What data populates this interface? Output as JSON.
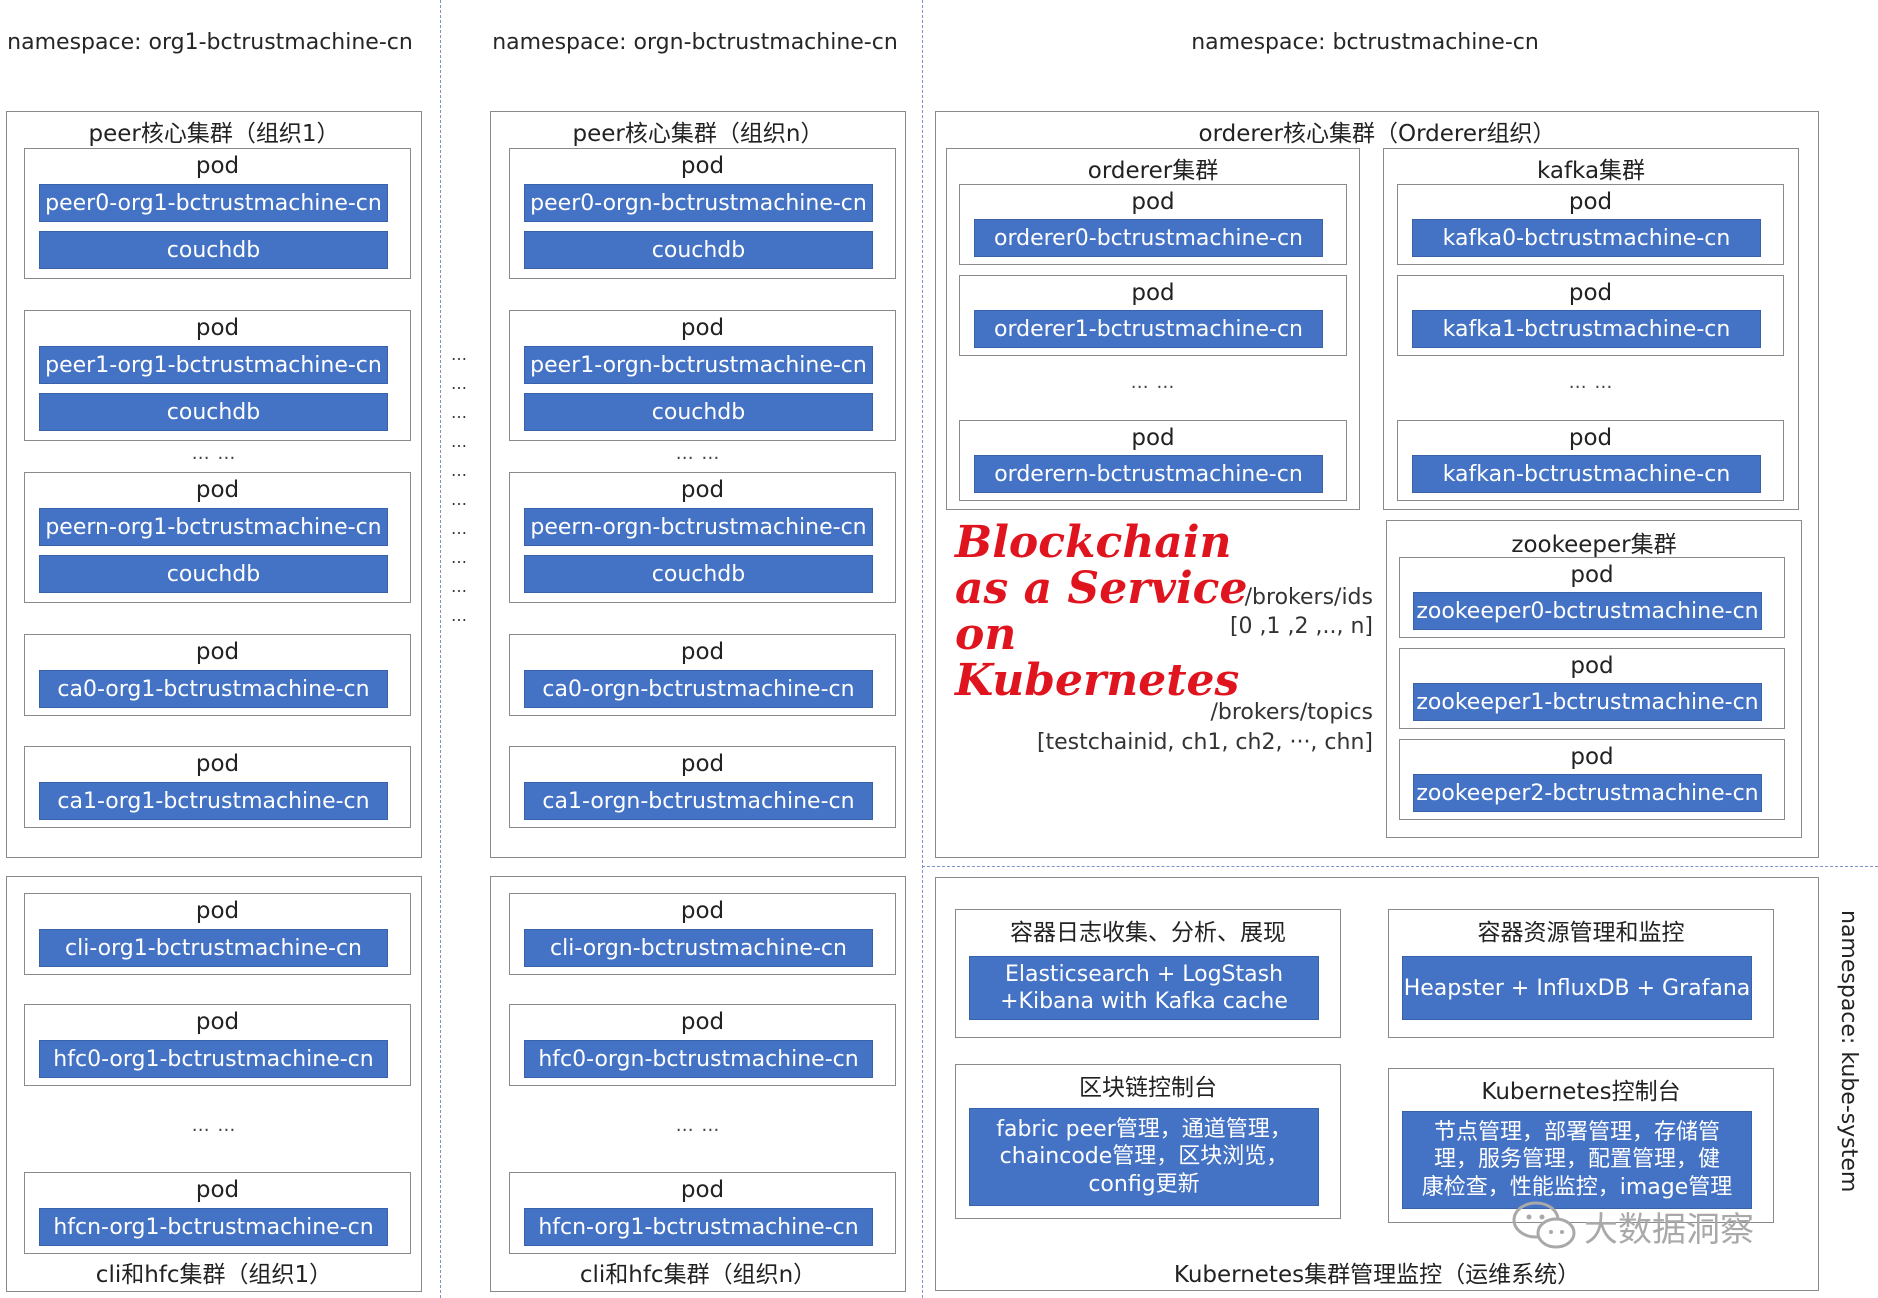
{
  "namespaces": {
    "org1": "namespace: org1-bctrustmachine-cn",
    "orgn": "namespace: orgn-bctrustmachine-cn",
    "orderer": "namespace: bctrustmachine-cn",
    "kube_system": "namespace: kube-system"
  },
  "org1": {
    "peer_cluster_title": "peer核心集群（组织1）",
    "pod_label": "pod",
    "peer0": "peer0-org1-bctrustmachine-cn",
    "peer1": "peer1-org1-bctrustmachine-cn",
    "peern": "peern-org1-bctrustmachine-cn",
    "couchdb": "couchdb",
    "ca0": "ca0-org1-bctrustmachine-cn",
    "ca1": "ca1-org1-bctrustmachine-cn",
    "cli": "cli-org1-bctrustmachine-cn",
    "hfc0": "hfc0-org1-bctrustmachine-cn",
    "hfcn": "hfcn-org1-bctrustmachine-cn",
    "cli_cluster_title": "cli和hfc集群（组织1）",
    "ellipsis": "… …"
  },
  "orgn": {
    "peer_cluster_title": "peer核心集群（组织n）",
    "pod_label": "pod",
    "peer0": "peer0-orgn-bctrustmachine-cn",
    "peer1": "peer1-orgn-bctrustmachine-cn",
    "peern": "peern-orgn-bctrustmachine-cn",
    "couchdb": "couchdb",
    "ca0": "ca0-orgn-bctrustmachine-cn",
    "ca1": "ca1-orgn-bctrustmachine-cn",
    "cli": "cli-orgn-bctrustmachine-cn",
    "hfc0": "hfc0-orgn-bctrustmachine-cn",
    "hfcn": "hfcn-org1-bctrustmachine-cn",
    "cli_cluster_title": "cli和hfc集群（组织n）",
    "ellipsis": "… …"
  },
  "middle_dots": "…",
  "orderer_org": {
    "title": "orderer核心集群（Orderer组织）",
    "orderer_cluster_title": "orderer集群",
    "kafka_cluster_title": "kafka集群",
    "zookeeper_cluster_title": "zookeeper集群",
    "pod_label": "pod",
    "orderer0": "orderer0-bctrustmachine-cn",
    "orderer1": "orderer1-bctrustmachine-cn",
    "orderern": "orderern-bctrustmachine-cn",
    "kafka0": "kafka0-bctrustmachine-cn",
    "kafka1": "kafka1-bctrustmachine-cn",
    "kafkan": "kafkan-bctrustmachine-cn",
    "zookeeper0": "zookeeper0-bctrustmachine-cn",
    "zookeeper1": "zookeeper1-bctrustmachine-cn",
    "zookeeper2": "zookeeper2-bctrustmachine-cn",
    "ellipsis": "… …",
    "brokers_ids_path": "/brokers/ids",
    "brokers_ids_value": "[0 ,1 ,2 ,.., n]",
    "brokers_topics_path": "/brokers/topics",
    "brokers_topics_value": "[testchainid, ch1, ch2, ···, chn]",
    "script_line1": "Blockchain",
    "script_line2": "as a Service",
    "script_line3": "on",
    "script_line4": "Kubernetes"
  },
  "kube_mgmt": {
    "logging_title": "容器日志收集、分析、展现",
    "logging_line1": "Elasticsearch + LogStash",
    "logging_line2": "+Kibana with Kafka cache",
    "monitor_title": "容器资源管理和监控",
    "monitor_value": "Heapster + InfluxDB + Grafana",
    "chain_console_title": "区块链控制台",
    "chain_console_line1": "fabric peer管理，通道管理，",
    "chain_console_line2": "chaincode管理，区块浏览，",
    "chain_console_line3": "config更新",
    "k8s_console_title": "Kubernetes控制台",
    "k8s_console_line1": "节点管理，部署管理，存储管",
    "k8s_console_line2": "理，服务管理，配置管理，健",
    "k8s_console_line3": "康检查，性能监控，image管理",
    "footer_title": "Kubernetes集群管理监控（运维系统）"
  },
  "watermark": "大数据洞察",
  "colors": {
    "bar_blue": "#4472c4",
    "script_red": "#e0141e",
    "separator": "#7f91c8"
  }
}
